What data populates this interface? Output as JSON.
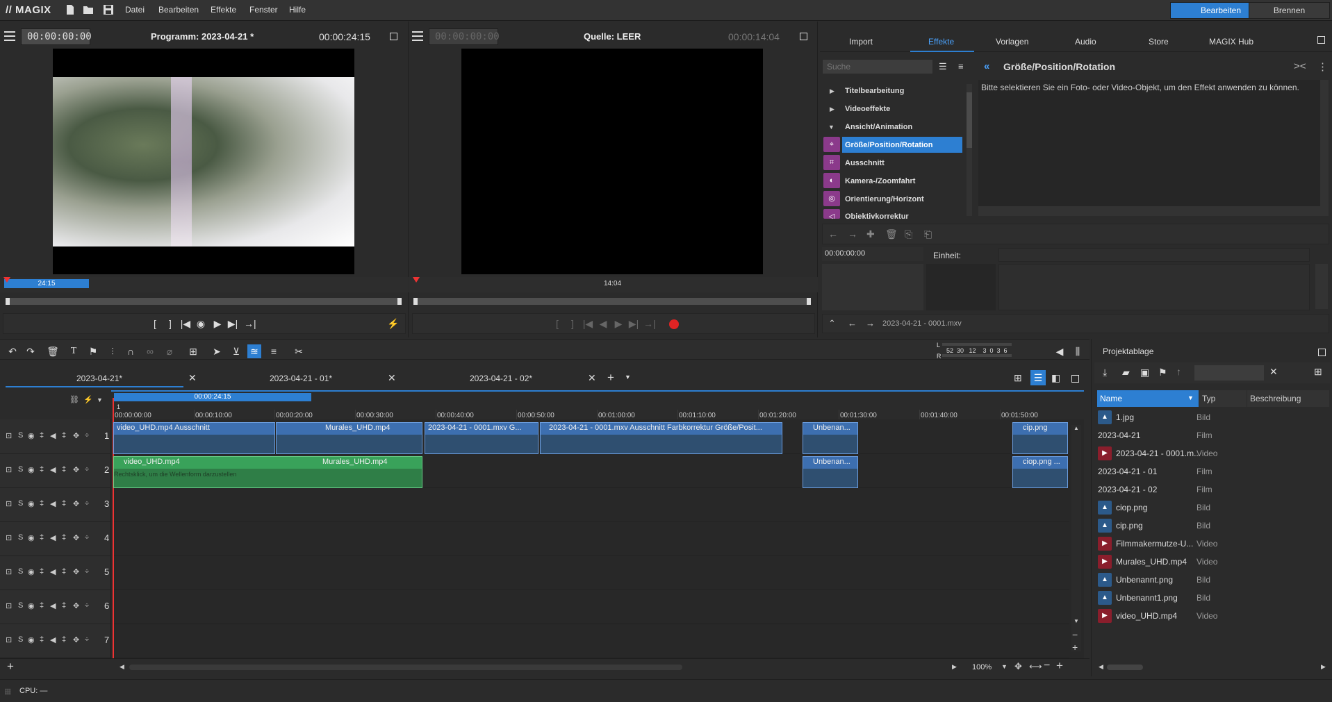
{
  "app": {
    "logo": "// MAGIX"
  },
  "menu": [
    "Datei",
    "Bearbeiten",
    "Effekte",
    "Fenster",
    "Hilfe"
  ],
  "modes": {
    "edit": "Bearbeiten",
    "burn": "Brennen"
  },
  "program_monitor": {
    "timecode": "00:00:00:00",
    "title": "Programm: 2023-04-21 *",
    "duration": "00:00:24:15",
    "marker": "24:15"
  },
  "source_monitor": {
    "timecode": "00:00:00:00",
    "title": "Quelle: LEER",
    "duration": "00:00:14:04",
    "marker": "14:04"
  },
  "right_tabs": [
    "Import",
    "Effekte",
    "Vorlagen",
    "Audio",
    "Store",
    "MAGIX Hub"
  ],
  "effects": {
    "search_placeholder": "Suche",
    "panel_title": "Größe/Position/Rotation",
    "message": "Bitte selektieren Sie ein Foto- oder Video-Objekt, um den Effekt anwenden zu können.",
    "tree": [
      {
        "label": "Titelbearbeitung",
        "type": "collapsed"
      },
      {
        "label": "Videoeffekte",
        "type": "collapsed"
      },
      {
        "label": "Ansicht/Animation",
        "type": "expanded"
      },
      {
        "label": "Größe/Position/Rotation",
        "type": "selected"
      },
      {
        "label": "Ausschnitt",
        "type": "child"
      },
      {
        "label": "Kamera-/Zoomfahrt",
        "type": "child"
      },
      {
        "label": "Orientierung/Horizont",
        "type": "child"
      },
      {
        "label": "Objektivkorrektur",
        "type": "child"
      }
    ],
    "keyframe_time": "00:00:00:00",
    "unit_label": "Einheit:",
    "footer_file": "2023-04-21 - 0001.mxv"
  },
  "meter": {
    "labels": "52  30   12    3  0  3  6",
    "l": "L",
    "r": "R"
  },
  "timeline_tabs": [
    "2023-04-21*",
    "2023-04-21 - 01*",
    "2023-04-21 - 02*"
  ],
  "timeline": {
    "range_label": "00:00:24:15",
    "marker": "1",
    "ruler": [
      "00:00:00:00",
      "00:00:10:00",
      "00:00:20:00",
      "00:00:30:00",
      "00:00:40:00",
      "00:00:50:00",
      "00:01:00:00",
      "00:01:10:00",
      "00:01:20:00",
      "00:01:30:00",
      "00:01:40:00",
      "00:01:50:00"
    ],
    "tracks": [
      "1",
      "2",
      "3",
      "4",
      "5",
      "6",
      "7"
    ],
    "track_controls": "S",
    "clips_track1": [
      "video_UHD.mp4   Ausschnitt",
      "Murales_UHD.mp4",
      "2023-04-21 - 0001.mxv   G...",
      "2023-04-21 - 0001.mxv   Ausschnitt   Farbkorrektur   Größe/Posit...",
      "Unbenan...",
      "cip.png"
    ],
    "clips_track2": [
      "video_UHD.mp4",
      "Murales_UHD.mp4",
      "Unbenan...",
      "ciop.png ..."
    ],
    "track2_hint": "Rechtsklick, um die Wellenform darzustellen",
    "zoom": "100%"
  },
  "project_bin": {
    "title": "Projektablage",
    "columns": [
      "Name",
      "Typ",
      "Beschreibung"
    ],
    "items": [
      {
        "name": "1.jpg",
        "type": "Bild",
        "icon": "image-icon"
      },
      {
        "name": "2023-04-21",
        "type": "Film",
        "icon": ""
      },
      {
        "name": "2023-04-21 - 0001.m...",
        "type": "Video",
        "icon": "video-icon"
      },
      {
        "name": "2023-04-21 - 01",
        "type": "Film",
        "icon": ""
      },
      {
        "name": "2023-04-21 - 02",
        "type": "Film",
        "icon": ""
      },
      {
        "name": "ciop.png",
        "type": "Bild",
        "icon": "image-icon"
      },
      {
        "name": "cip.png",
        "type": "Bild",
        "icon": "image-icon"
      },
      {
        "name": "Filmmakermutze-U...",
        "type": "Video",
        "icon": "video-icon"
      },
      {
        "name": "Murales_UHD.mp4",
        "type": "Video",
        "icon": "video-icon"
      },
      {
        "name": "Unbenannt.png",
        "type": "Bild",
        "icon": "image-icon"
      },
      {
        "name": "Unbenannt1.png",
        "type": "Bild",
        "icon": "image-icon"
      },
      {
        "name": "video_UHD.mp4",
        "type": "Video",
        "icon": "video-icon"
      }
    ]
  },
  "status": {
    "cpu": "CPU: —"
  }
}
